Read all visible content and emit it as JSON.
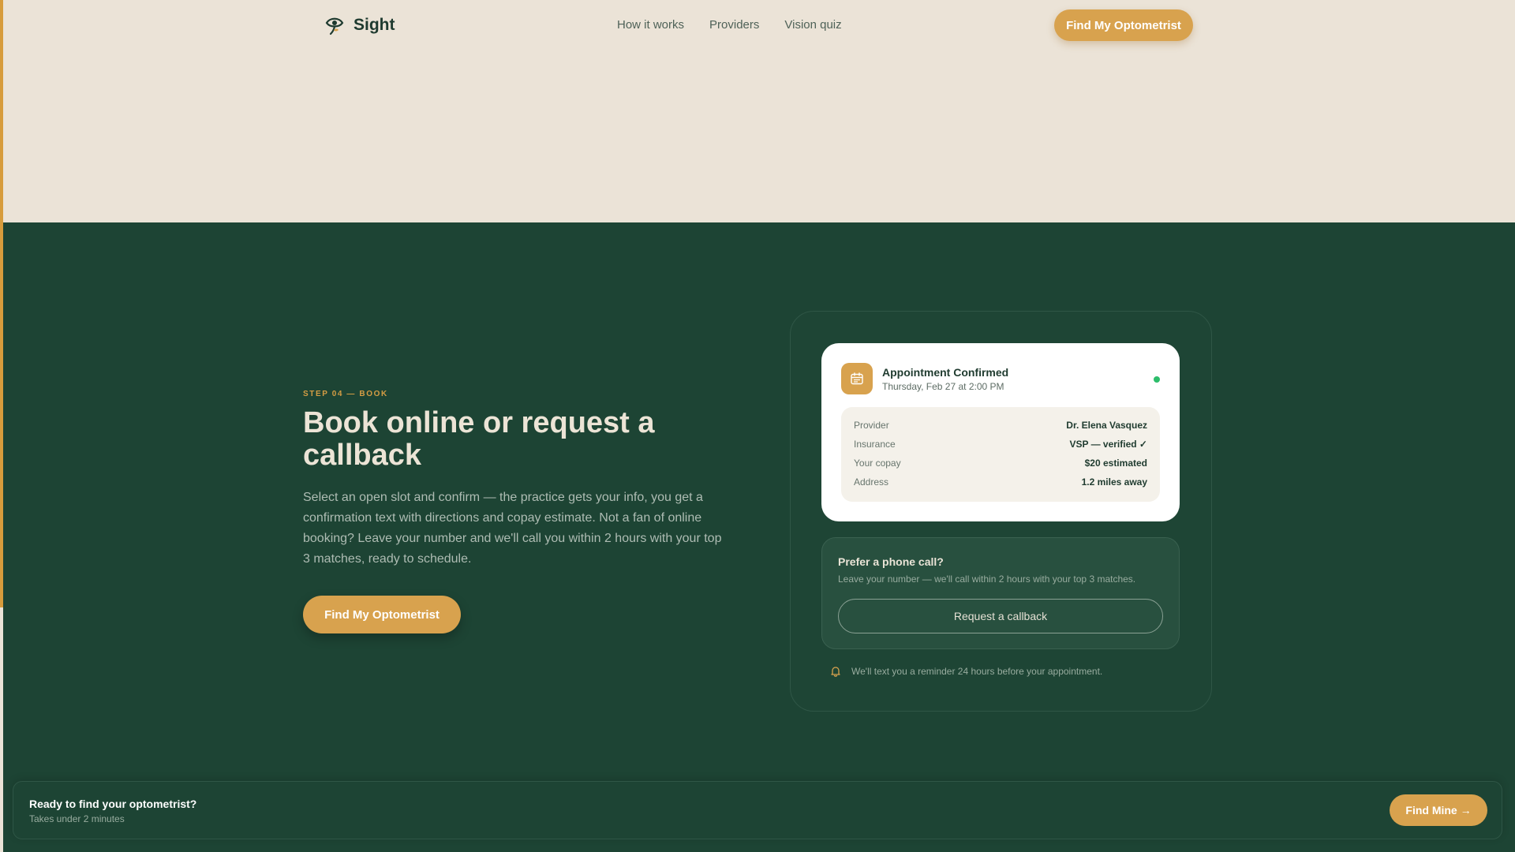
{
  "brand": {
    "name": "Sight",
    "accent_color": "#d8a24e",
    "dark_green": "#1d4434",
    "cream": "#ebe3d7",
    "logo_icon": "eye-sprout-icon"
  },
  "nav": {
    "links": [
      "How it works",
      "Providers",
      "Vision quiz"
    ],
    "cta_label": "Find My Optometrist"
  },
  "step": {
    "label": "STEP 04 — BOOK",
    "headline": "Book online or request a callback",
    "body": "Select an open slot and confirm — the practice gets your info, you get a confirmation text with directions and copay estimate. Not a fan of online booking? Leave your number and we'll call you within 2 hours with your top 3 matches, ready to schedule.",
    "cta_label": "Find My Optometrist"
  },
  "appointment": {
    "icon": "calendar-icon",
    "title": "Appointment Confirmed",
    "subtitle": "Thursday, Feb 27 at 2:00 PM",
    "status_color": "#2dbd6b",
    "details": [
      {
        "label": "Provider",
        "value": "Dr. Elena Vasquez"
      },
      {
        "label": "Insurance",
        "value": "VSP — verified ✓"
      },
      {
        "label": "Your copay",
        "value": "$20 estimated"
      },
      {
        "label": "Address",
        "value": "1.2 miles away"
      }
    ]
  },
  "phone": {
    "title": "Prefer a phone call?",
    "subtitle": "Leave your number — we'll call within 2 hours with your top 3 matches.",
    "button_label": "Request a callback"
  },
  "reminder": {
    "icon": "bell-icon",
    "text": "We'll text you a reminder 24 hours before your appointment."
  },
  "bottom_bar": {
    "title": "Ready to find your optometrist?",
    "subtitle": "Takes under 2 minutes",
    "cta_label": "Find Mine →"
  }
}
